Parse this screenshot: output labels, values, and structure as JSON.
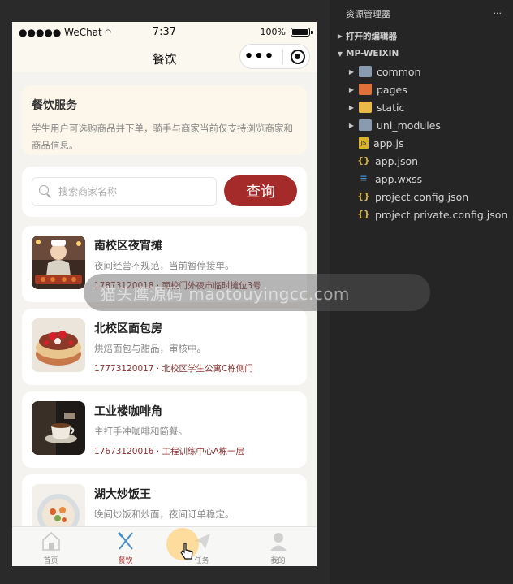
{
  "status_bar": {
    "carrier": "●●●●● WeChat",
    "time": "7:37",
    "battery": "100%"
  },
  "nav": {
    "title": "餐饮",
    "capsule_more": "•••"
  },
  "info": {
    "title": "餐饮服务",
    "desc": "学生用户可选购商品并下单，骑手与商家当前仅支持浏览商家和商品信息。"
  },
  "search": {
    "placeholder": "搜索商家名称",
    "button": "查询"
  },
  "shops": [
    {
      "name": "南校区夜宵摊",
      "desc": "夜间经营不规范，当前暂停接单。",
      "meta": "17873120018 · 南校门外夜市临时摊位3号"
    },
    {
      "name": "北校区面包房",
      "desc": "烘焙面包与甜品，审核中。",
      "meta": "17773120017 · 北校区学生公寓C栋侧门"
    },
    {
      "name": "工业楼咖啡角",
      "desc": "主打手冲咖啡和简餐。",
      "meta": "17673120016 · 工程训练中心A栋一层"
    },
    {
      "name": "湖大炒饭王",
      "desc": "晚间炒饭和炒面，夜间订单稳定。",
      "meta": ""
    }
  ],
  "tabs": [
    {
      "label": "首页"
    },
    {
      "label": "餐饮"
    },
    {
      "label": "任务"
    },
    {
      "label": "我的"
    }
  ],
  "ide": {
    "header": "资源管理器",
    "header_more": "···",
    "open_editors": "打开的编辑器",
    "project": "MP-WEIXIN",
    "files": [
      {
        "name": "common",
        "type": "folder"
      },
      {
        "name": "pages",
        "type": "folder"
      },
      {
        "name": "static",
        "type": "folder"
      },
      {
        "name": "uni_modules",
        "type": "folder"
      },
      {
        "name": "app.js",
        "type": "js"
      },
      {
        "name": "app.json",
        "type": "json"
      },
      {
        "name": "app.wxss",
        "type": "wxss"
      },
      {
        "name": "project.config.json",
        "type": "json"
      },
      {
        "name": "project.private.config.json",
        "type": "json"
      }
    ]
  },
  "watermark": "猫头鹰源码 maotouyingcc.com",
  "colors": {
    "accent": "#a52a2a",
    "page_bg": "#f4f3ef",
    "ide_bg": "#252526"
  }
}
